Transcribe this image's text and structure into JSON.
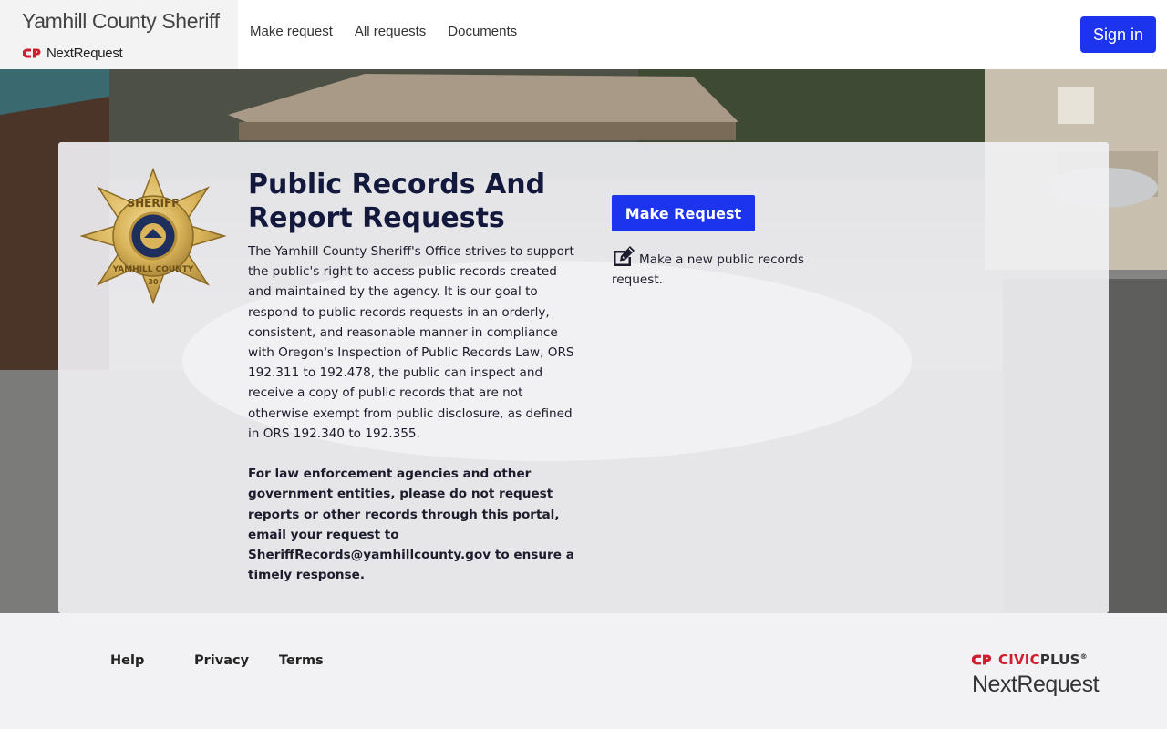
{
  "header": {
    "agency_name": "Yamhill County Sheriff",
    "product_name": "NextRequest",
    "nav": [
      "Make request",
      "All requests",
      "Documents"
    ],
    "sign_in": "Sign in"
  },
  "hero": {
    "title": "Public Records And Report Requests",
    "description": "The Yamhill County Sheriff's Office strives to support the public's right to access public records created and maintained by the agency. It is our goal to respond to public records requests in an orderly, consistent, and reasonable manner in compliance with Oregon's Inspection of Public Records Law, ORS 192.311 to 192.478, the public can inspect and receive a copy of public records that are not otherwise exempt from public disclosure, as defined in ORS 192.340 to 192.355.",
    "note_prefix": "For law enforcement agencies and other government entities, please do not request reports or other records through this portal, email your request to ",
    "note_email": "SheriffRecords@yamhillcounty.gov",
    "note_suffix": " to ensure a timely response.",
    "make_request_button": "Make Request",
    "make_request_description": "Make a new public records request.",
    "badge": {
      "top_text": "SHERIFF",
      "bottom_text": "YAMHILL COUNTY",
      "number": "30"
    }
  },
  "footer": {
    "links": [
      "Help",
      "Privacy",
      "Terms"
    ],
    "civicplus_civic": "CIVIC",
    "civicplus_plus": "PLUS",
    "civicplus_tm": "®",
    "nextrequest": "NextRequest"
  },
  "colors": {
    "primary_button": "#1d34ee",
    "title_navy": "#13183d",
    "brand_red": "#d01e2e"
  },
  "icons": [
    "civicplus-logo-icon",
    "sheriff-badge-icon",
    "edit-icon"
  ]
}
